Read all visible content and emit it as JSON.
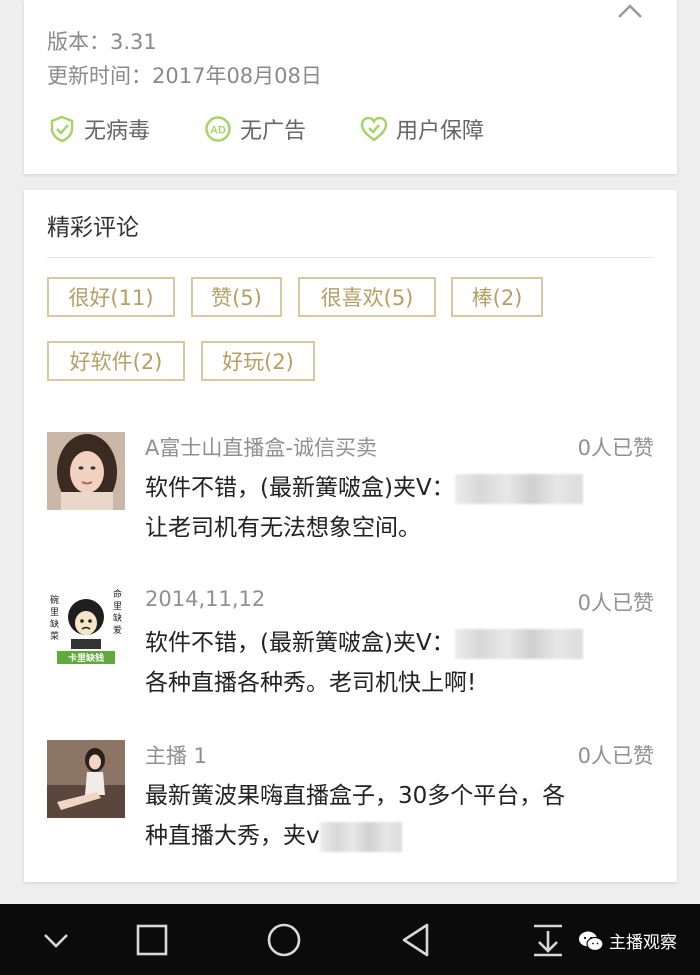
{
  "app_info": {
    "version": "版本：3.31",
    "update_time": "更新时间：2017年08月08日",
    "badges": [
      {
        "label": "无病毒",
        "icon": "shield-check-icon"
      },
      {
        "label": "无广告",
        "icon": "ad-block-icon"
      },
      {
        "label": "用户保障",
        "icon": "heart-guarantee-icon"
      }
    ]
  },
  "comments_section": {
    "title": "精彩评论",
    "tags": [
      "很好(11)",
      "赞(5)",
      "很喜欢(5)",
      "棒(2)",
      "好软件(2)",
      "好玩(2)"
    ],
    "items": [
      {
        "user": "A富士山直播盒-诚信买卖",
        "likes": "0人已赞",
        "text_line1": "软件不错，(最新簧啵盒)夹V：",
        "text_line2": "让老司机有无法想象空间。"
      },
      {
        "user": "2014,11,12",
        "likes": "0人已赞",
        "text_line1": "软件不错，(最新簧啵盒)夹V：",
        "text_line2": "各种直播各种秀。老司机快上啊!",
        "avatar_text": {
          "left": "碗里缺菜",
          "right": "命里缺爱",
          "bottom": "卡里缺钱"
        }
      },
      {
        "user": "主播 1",
        "likes": "0人已赞",
        "text_line1": "最新簧波果嗨直播盒子，30多个平台，各",
        "text_line2": "种直播大秀，夹v"
      }
    ]
  },
  "nav_bar": {
    "watermark": "主播观察",
    "icons": [
      "chevron-down-icon",
      "square-icon",
      "circle-icon",
      "triangle-back-icon",
      "download-icon"
    ]
  },
  "colors": {
    "tag_border": "#d8c89d",
    "tag_text": "#b59f64",
    "badge_green": "#a8d36a",
    "navbar": "#0b0b0b"
  }
}
